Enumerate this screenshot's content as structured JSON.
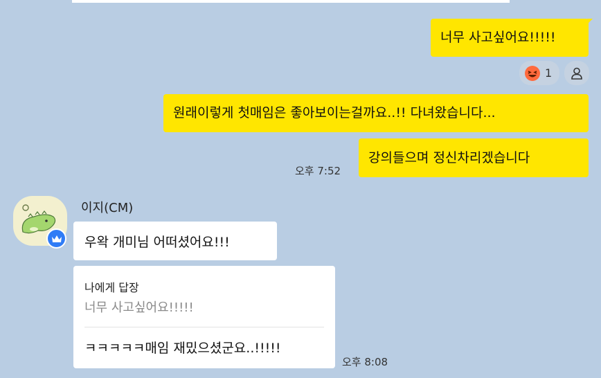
{
  "messages_sent": [
    {
      "text": "너무 사고싶어요!!!!!"
    },
    {
      "text": "원래이렇게 첫매임은 좋아보이는걸까요..!! 다녀왔습니다..."
    },
    {
      "text": "강의들으며 정신차리겠습니다"
    }
  ],
  "reaction": {
    "emoji": "😆",
    "count": "1"
  },
  "sent_time": "오후 7:52",
  "sender": {
    "name": "이지(CM)"
  },
  "messages_received": [
    {
      "text": "우왁 개미님 어떠셨어요!!!"
    }
  ],
  "reply": {
    "header": "나에게 답장",
    "quoted": "너무 사고싶어요!!!!!",
    "text": "ㅋㅋㅋㅋㅋ매임 재밌으셨군요..!!!!!",
    "time": "오후 8:08"
  },
  "colors": {
    "background": "#b9cde3",
    "sent_bubble": "#ffe600",
    "received_bubble": "#ffffff",
    "badge": "#2f7cf6"
  }
}
